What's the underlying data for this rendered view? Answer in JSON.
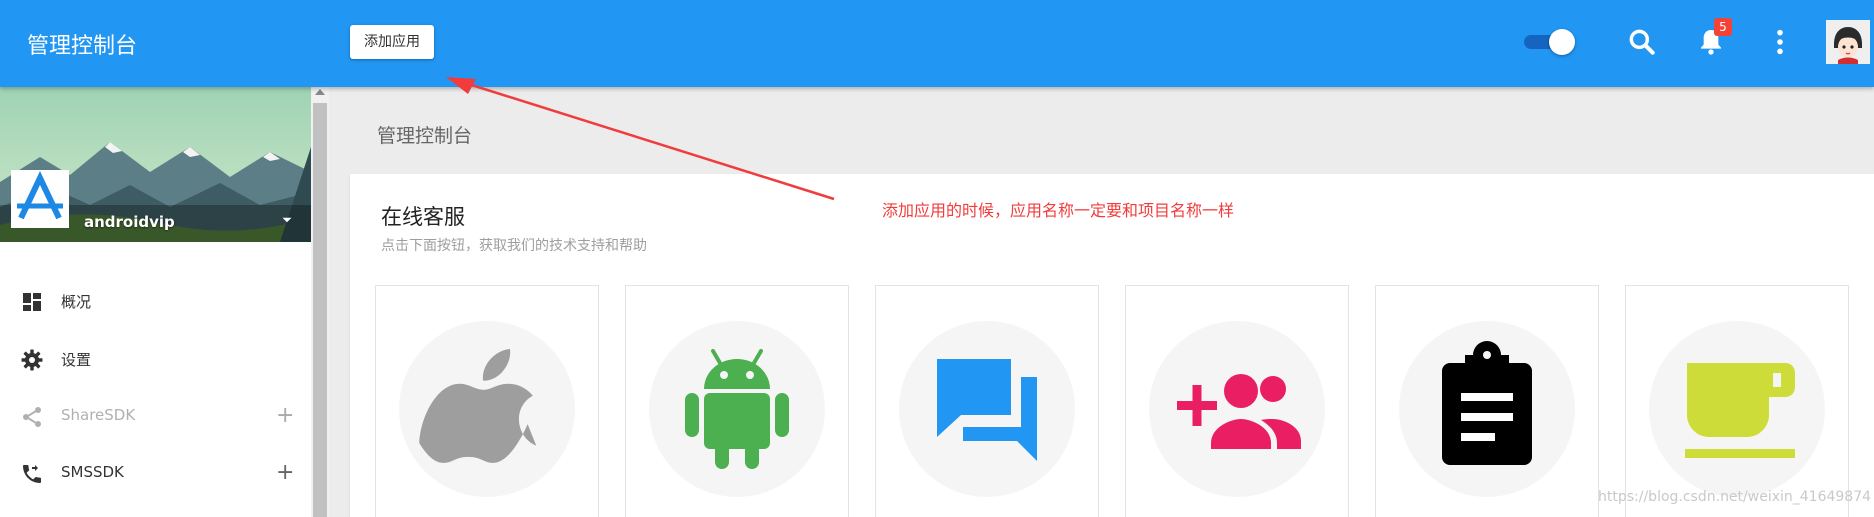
{
  "header": {
    "title": "管理控制台",
    "add_app_label": "添加应用",
    "notification_count": "5",
    "theme_toggle_on": true,
    "icons": [
      "search-icon",
      "bell-icon",
      "more-vert-icon"
    ],
    "accent_color": "#2196f3"
  },
  "sidebar": {
    "project_name": "androidvip",
    "items": [
      {
        "label": "概况",
        "icon": "dashboard-icon",
        "enabled": true,
        "expandable": false
      },
      {
        "label": "设置",
        "icon": "gear-icon",
        "enabled": true,
        "expandable": false
      },
      {
        "label": "ShareSDK",
        "icon": "share-icon",
        "enabled": false,
        "expandable": true,
        "expand_symbol": "+"
      },
      {
        "label": "SMSSDK",
        "icon": "phone-forward-icon",
        "enabled": true,
        "expandable": true,
        "expand_symbol": "+"
      }
    ]
  },
  "main": {
    "breadcrumb": "管理控制台",
    "card": {
      "title": "在线客服",
      "subtitle": "点击下面按钮，获取我们的技术支持和帮助",
      "tiles": [
        {
          "icon": "apple-icon",
          "color": "#9e9e9e"
        },
        {
          "icon": "android-icon",
          "color": "#4caf50"
        },
        {
          "icon": "chat-icon",
          "color": "#2196f3"
        },
        {
          "icon": "add-group-icon",
          "color": "#e91e63"
        },
        {
          "icon": "clipboard-icon",
          "color": "#000000"
        },
        {
          "icon": "coffee-cup-icon",
          "color": "#cddc39"
        }
      ]
    }
  },
  "annotation": {
    "text": "添加应用的时候，应用名称一定要和项目名称一样",
    "color": "#f03c3c"
  },
  "watermark": "https://blog.csdn.net/weixin_41649874"
}
